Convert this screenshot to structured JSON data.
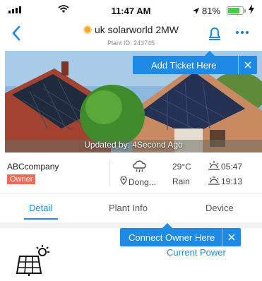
{
  "status_bar": {
    "time": "11:47 AM",
    "battery_pct": "81%",
    "battery_level": 0.81,
    "icons": [
      "signal-icon",
      "wifi-icon",
      "location-arrow-icon",
      "battery-icon",
      "charging-icon"
    ]
  },
  "nav": {
    "title": "uk solarworld 2MW",
    "subtitle": "Plant ID: 243745",
    "status_color": "#f5a623",
    "icons": [
      "back-icon",
      "bell-icon",
      "more-icon"
    ]
  },
  "hero": {
    "caption": "Updated by: 4Second Ago"
  },
  "tooltips": {
    "add_ticket": "Add Ticket Here",
    "connect_owner": "Connect Owner Here"
  },
  "info": {
    "company": "ABCcompany",
    "role": "Owner",
    "location": "Dong...",
    "temperature": "29°C",
    "weather": "Rain",
    "sunrise": "05:47",
    "sunset": "19:13"
  },
  "tabs": {
    "detail": "Detail",
    "plant_info": "Plant Info",
    "device": "Device",
    "active": "Detail"
  },
  "content": {
    "current_power_label": "Current Power"
  },
  "colors": {
    "accent": "#1d8be6",
    "owner_badge": "#f06b55",
    "battery": "#3fd13f"
  }
}
